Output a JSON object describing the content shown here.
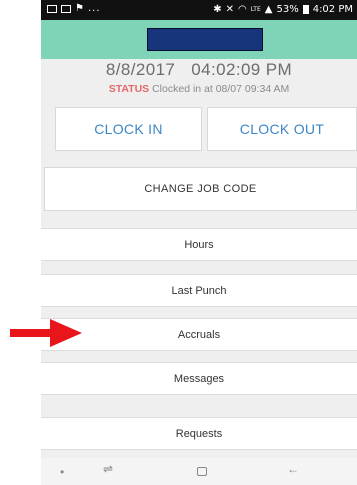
{
  "statusbar": {
    "left_icons": [
      "image-icon",
      "message-icon",
      "flag-icon"
    ],
    "overflow": "...",
    "network": "LTE",
    "battery": "53%",
    "time": "4:02 PM"
  },
  "datetime": {
    "date": "8/8/2017",
    "time": "04:02:09 PM"
  },
  "status": {
    "label": "STATUS",
    "text": "Clocked in at 08/07 09:34 AM"
  },
  "buttons": {
    "clock_in": "CLOCK IN",
    "clock_out": "CLOCK OUT",
    "change_job_code": "CHANGE JOB CODE"
  },
  "menu": [
    {
      "label": "Hours"
    },
    {
      "label": "Last Punch"
    },
    {
      "label": "Accruals"
    },
    {
      "label": "Messages"
    },
    {
      "label": "Requests"
    }
  ],
  "colors": {
    "header": "#7fd3b7",
    "accent": "#3c86c5",
    "status_label": "#e26a6a",
    "arrow": "#e8151b",
    "redaction": "#16357a"
  },
  "annotation": {
    "type": "arrow",
    "points_to": "Accruals"
  }
}
